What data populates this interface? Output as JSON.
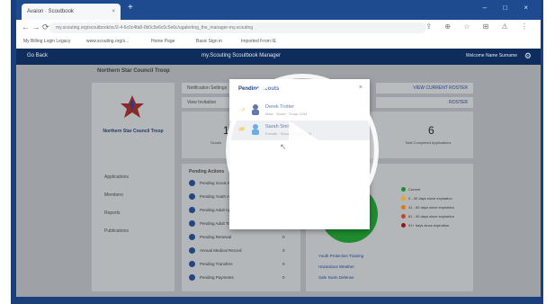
{
  "browser": {
    "tab_title": "Avaion · Scoutbook",
    "tab_close": "×",
    "new_tab": "+",
    "window_controls": "– □ ×",
    "nav_buttons": "← → ⟳",
    "url": "my.scouting.org/scoutbook/sc/2-4-6c0c4fa8-0b0c5e6c0c5e6c/ugalerting_the_manager-my.scouting",
    "address_icons": [
      "share-icon",
      "zoom-icon",
      "star-icon",
      "extension-icon",
      "alert-icon",
      "menu-icon"
    ],
    "address_icons_glyphs": "⇪ ⊕ ☆ ⊞ ⚠ ⋮"
  },
  "bookmarks": [
    "My Billing Login Legacy",
    "www.scouting.org/s...",
    "Home Page",
    "Basic Sign in",
    "Imported From IE"
  ],
  "appbar": {
    "back": "Go Back",
    "title": "my.Scouting  Scoutbook Manager",
    "user": "Welcome Name Surname"
  },
  "unit": {
    "header": "Northern Star Council Troop"
  },
  "left_menu": {
    "troop_name": "Northern Star Council Troop",
    "items": [
      "Applications",
      "Members",
      "Reports",
      "Publications"
    ]
  },
  "top_strips": [
    "Notification Settings",
    "View Invitation",
    "VIEW CURRENT ROSTER",
    "ROSTER"
  ],
  "stats": [
    {
      "value": "11",
      "label": "Scouts"
    },
    {
      "value": "6",
      "label": "Total Completed Applications"
    }
  ],
  "pending_card": {
    "title": "Pending Actions",
    "rows": [
      {
        "label": "Pending Scout Applications",
        "value": "0"
      },
      {
        "label": "Pending Youth Applications",
        "value": "0"
      },
      {
        "label": "Pending Adult Applications",
        "value": "0"
      },
      {
        "label": "Pending Adult Training",
        "value": "0"
      },
      {
        "label": "Pending Renewal",
        "value": "0"
      },
      {
        "label": "Annual Medical Record",
        "value": "0"
      },
      {
        "label": "Pending Transfers",
        "value": "0"
      },
      {
        "label": "Pending Payments",
        "value": "0"
      }
    ]
  },
  "chart_legend": [
    {
      "label": "Current",
      "color": "#1e8c2e"
    },
    {
      "label": "0 - 30 days since expiration",
      "color": "#e7a52b"
    },
    {
      "label": "31 - 60 days since expiration",
      "color": "#d97a1c"
    },
    {
      "label": "61 - 90 days since expiration",
      "color": "#c4462b"
    },
    {
      "label": "91+ days since expiration",
      "color": "#8a1c1c"
    }
  ],
  "chart_links": [
    "Youth Protection Training",
    "Hazardous Weather",
    "Safe Swim Defense"
  ],
  "chart_data": {
    "type": "pie",
    "categories": [
      "Current",
      "0 - 30 days since expiration",
      "31 - 60 days since expiration"
    ],
    "values": [
      70,
      20,
      10
    ],
    "colors": [
      "#1e8c2e",
      "#e7a52b",
      "#d9d9d9"
    ],
    "title": ""
  },
  "modal": {
    "title": "Pending Scouts",
    "close": "×",
    "items": [
      {
        "name": "Derek Trotter",
        "sub": "Male · Scout · Troop 1234"
      },
      {
        "name": "Sarah Smith",
        "sub": "Female · Scout · Troop 1234"
      }
    ]
  },
  "video_overlay": {
    "play_icon": "play-icon"
  }
}
